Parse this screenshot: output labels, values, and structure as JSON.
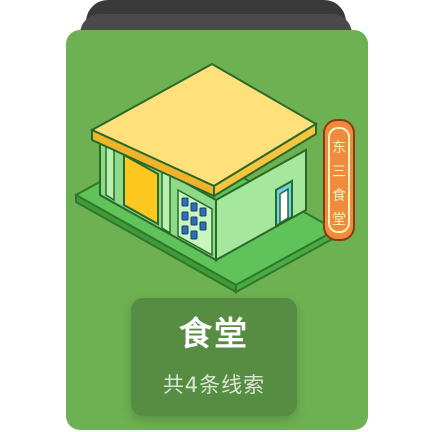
{
  "card": {
    "place_name": "食堂",
    "clue_count_text": "共4条线索",
    "illustration_icon": "canteen-building-icon",
    "sign_chars": [
      "东",
      "三",
      "食",
      "堂"
    ],
    "colors": {
      "card_bg": "#6db152",
      "roof": "#ffe07a",
      "wall": "#8fd98a",
      "door": "#ffc820",
      "sign": "#f08a3c"
    }
  }
}
